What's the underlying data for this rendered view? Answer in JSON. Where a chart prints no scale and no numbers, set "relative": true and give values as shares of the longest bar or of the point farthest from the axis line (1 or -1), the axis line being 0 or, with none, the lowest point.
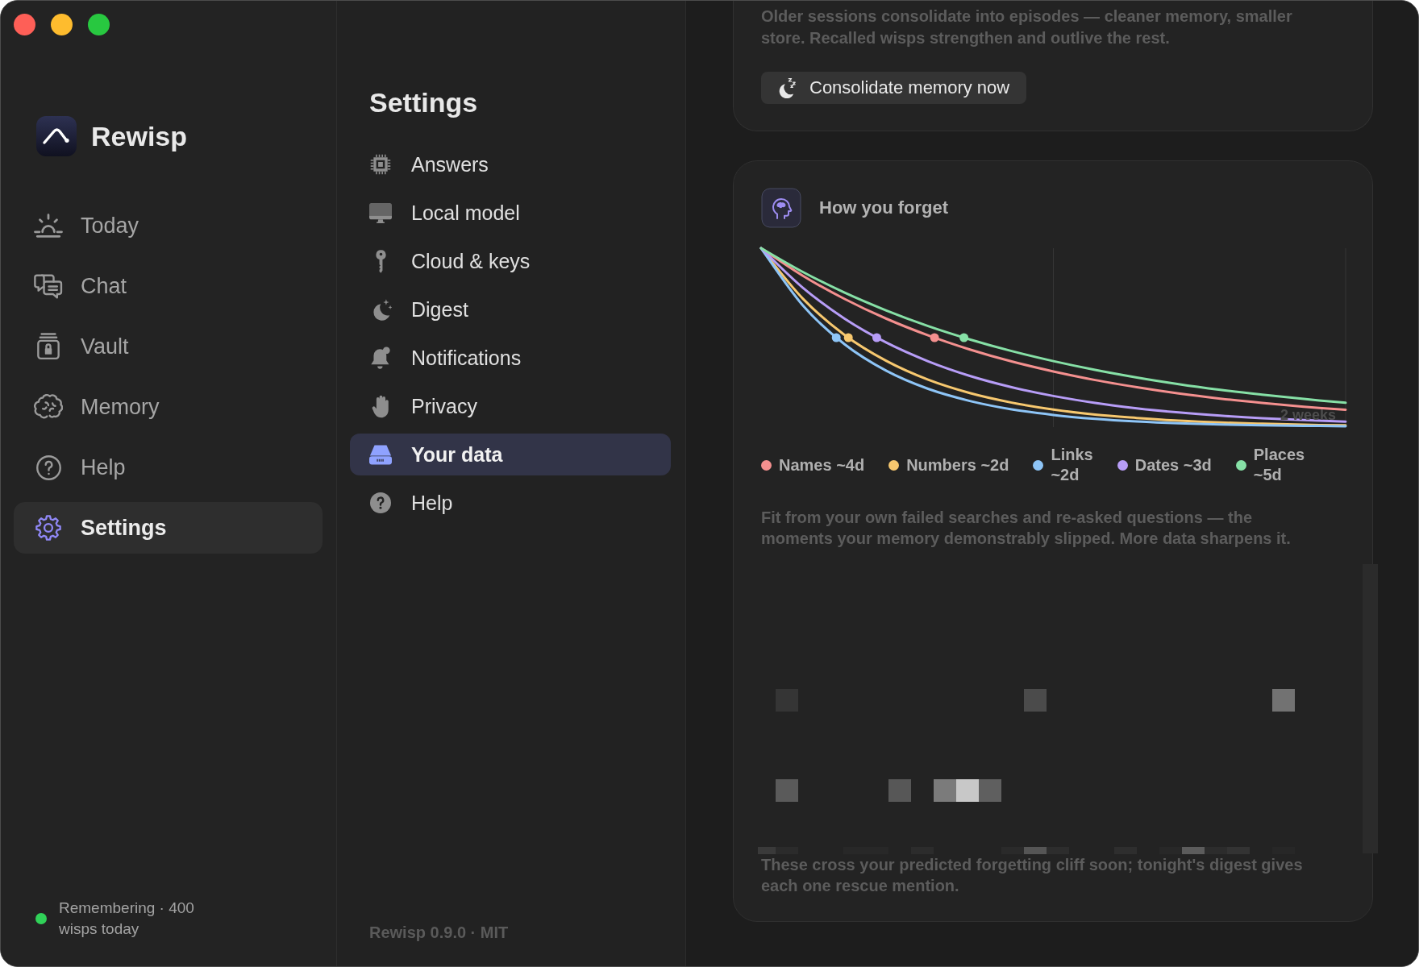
{
  "sidebar": {
    "app_name": "Rewisp",
    "items": [
      {
        "label": "Today",
        "selected": false
      },
      {
        "label": "Chat",
        "selected": false
      },
      {
        "label": "Vault",
        "selected": false
      },
      {
        "label": "Memory",
        "selected": false
      },
      {
        "label": "Help",
        "selected": false
      },
      {
        "label": "Settings",
        "selected": true
      }
    ],
    "status": {
      "text": "Remembering · 400 wisps today",
      "active": true
    }
  },
  "settings_nav": {
    "title": "Settings",
    "items": [
      {
        "label": "Answers",
        "selected": false
      },
      {
        "label": "Local model",
        "selected": false
      },
      {
        "label": "Cloud & keys",
        "selected": false
      },
      {
        "label": "Digest",
        "selected": false
      },
      {
        "label": "Notifications",
        "selected": false
      },
      {
        "label": "Privacy",
        "selected": false
      },
      {
        "label": "Your data",
        "selected": true
      },
      {
        "label": "Help",
        "selected": false
      }
    ],
    "footer": "Rewisp 0.9.0 · MIT"
  },
  "content": {
    "consolidate_card": {
      "description": "Older sessions consolidate into episodes — cleaner memory, smaller store. Recalled wisps strengthen and outlive the rest.",
      "button": "Consolidate memory now"
    },
    "forget_card": {
      "title": "How you forget",
      "chart_data": {
        "type": "line",
        "relative": true,
        "series": [
          {
            "name": "Names ~4d",
            "color": "#f4908f",
            "values": [
              1,
              0.846,
              0.716,
              0.606,
              0.513,
              0.434,
              0.367,
              0.311,
              0.263,
              0.223,
              0.188,
              0.159,
              0.135,
              0.114,
              0.097
            ]
          },
          {
            "name": "Numbers ~2d",
            "color": "#f7c86f",
            "values": [
              1,
              0.718,
              0.515,
              0.37,
              0.265,
              0.19,
              0.137,
              0.098,
              0.07,
              0.051,
              0.036,
              0.026,
              0.019,
              0.013,
              0.01
            ]
          },
          {
            "name": "Links ~2d",
            "color": "#8ec5f7",
            "values": [
              1,
              0.68,
              0.463,
              0.315,
              0.214,
              0.146,
              0.099,
              0.068,
              0.046,
              0.031,
              0.021,
              0.015,
              0.01,
              0.007,
              0.005
            ]
          },
          {
            "name": "Dates ~3d",
            "color": "#b79df7",
            "values": [
              1,
              0.779,
              0.606,
              0.472,
              0.368,
              0.286,
              0.223,
              0.174,
              0.135,
              0.105,
              0.082,
              0.064,
              0.05,
              0.039,
              0.03
            ]
          },
          {
            "name": "Places ~5d",
            "color": "#86e0a6",
            "values": [
              1,
              0.867,
              0.752,
              0.652,
              0.565,
              0.49,
              0.425,
              0.369,
              0.32,
              0.277,
              0.24,
              0.208,
              0.181,
              0.157,
              0.136
            ]
          }
        ],
        "annotations": [
          "2 weeks"
        ]
      },
      "description": "Fit from your own failed searches and re-asked questions — the moments your memory demonstrably slipped. More data sharpens it.",
      "footnote": "These cross your predicted forgetting cliff soon; tonight's digest gives each one rescue mention."
    }
  }
}
